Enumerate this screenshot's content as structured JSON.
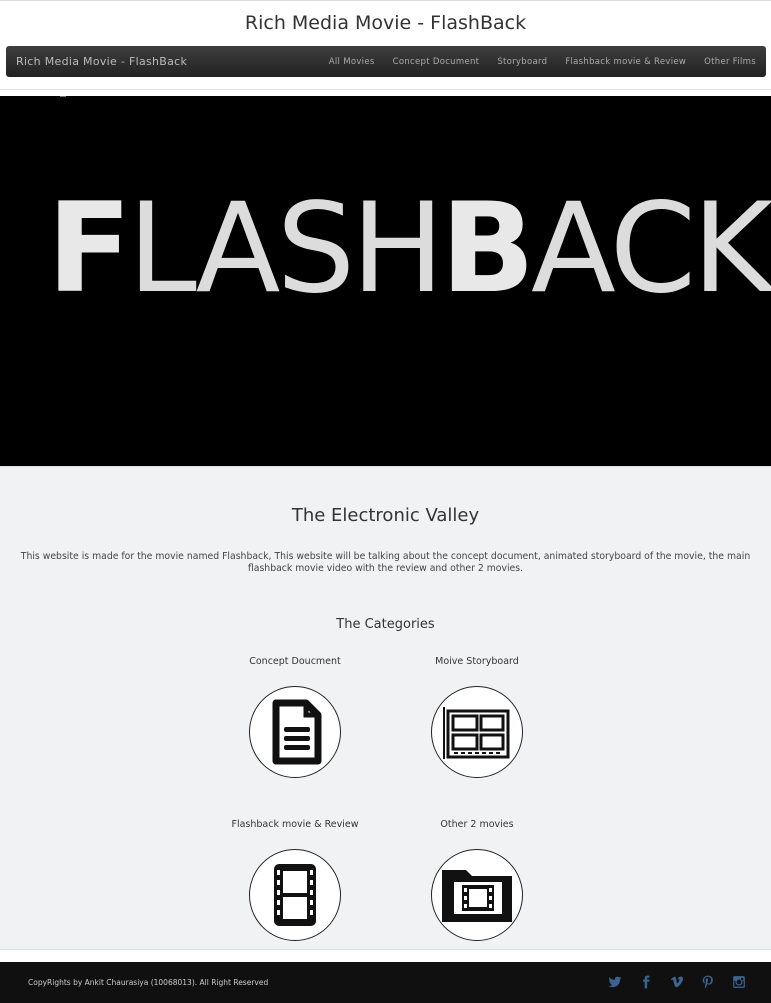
{
  "site": {
    "title": "Rich Media Movie - FlashBack"
  },
  "navbar": {
    "brand": "Rich Media Movie - FlashBack",
    "links": [
      "All Movies",
      "Concept Document",
      "Storyboard",
      "Flashback movie & Review",
      "Other Films"
    ]
  },
  "hero": {
    "letter1": "F",
    "part1": "LASH",
    "letter2": "B",
    "part2": "ACK"
  },
  "content": {
    "heading": "The Electronic Valley",
    "intro": "This website is made for the movie named Flashback, This website will be talking about the concept document, animated storyboard of the movie, the main flashback movie video with the review and other 2 movies.",
    "categories_title": "The Categories",
    "categories": [
      {
        "label": "Concept Doucment",
        "icon": "document-icon"
      },
      {
        "label": "Moive Storyboard",
        "icon": "storyboard-icon"
      },
      {
        "label": "Flashback movie & Review",
        "icon": "film-strip-icon"
      },
      {
        "label": "Other 2 movies",
        "icon": "film-folder-icon"
      }
    ]
  },
  "footer": {
    "copyright": "CopyRights by Ankit Chaurasiya (10068013). All Right Reserved",
    "socials": [
      "twitter-icon",
      "facebook-icon",
      "vimeo-icon",
      "pinterest-icon",
      "instagram-icon"
    ],
    "social_color": "#3d6491"
  }
}
